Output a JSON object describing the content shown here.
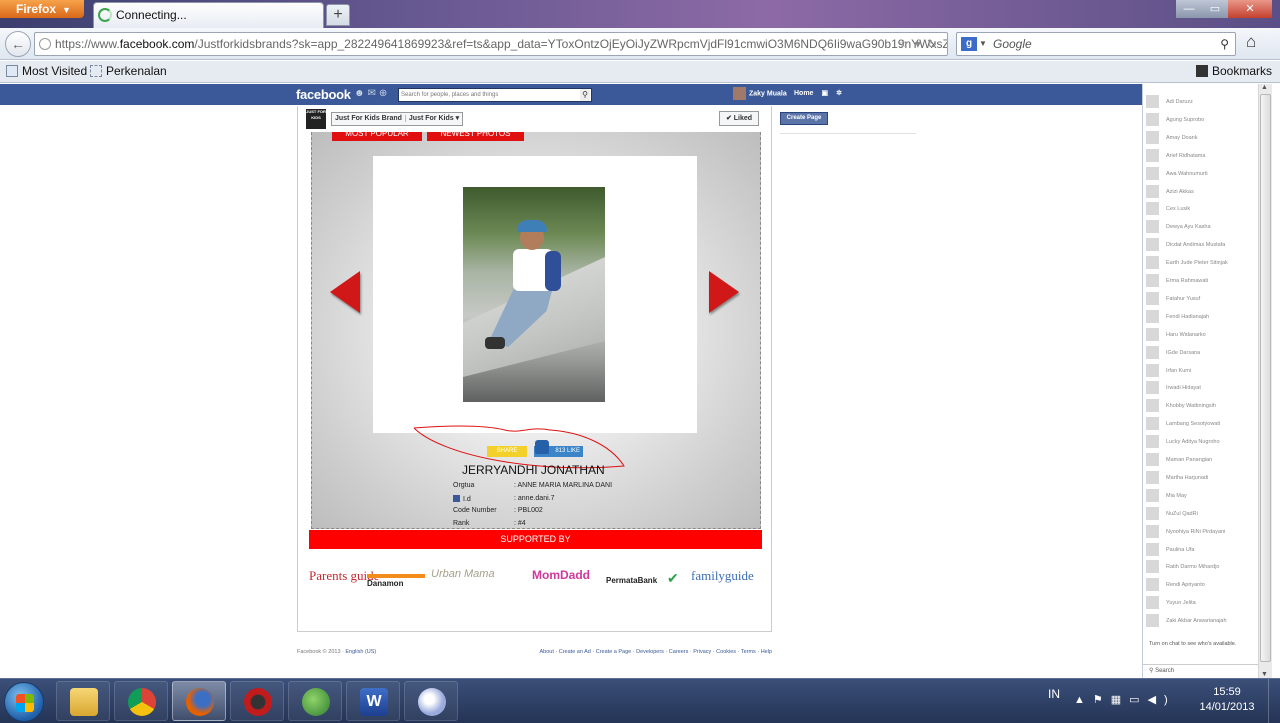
{
  "browser": {
    "menu_label": "Firefox",
    "tab_title": "Connecting...",
    "new_tab_label": "+",
    "url_prefix": "https://www.",
    "url_domain": "facebook.com",
    "url_rest": "/Justforkidsbrands?sk=app_282249641869923&ref=ts&app_data=YToxOntzOjEyOiJyZWRpcmVjdFl91cmwiO3M6NDQ6Ii9waG90b19nYWxsZXJ5L",
    "search_engine": "Google",
    "search_placeholder": "Google",
    "bookmarks": [
      "Most Visited",
      "Perkenalan"
    ],
    "bookmarks_menu": "Bookmarks"
  },
  "facebook": {
    "logo": "facebook",
    "search_placeholder": "Search for people, places and things",
    "user_name": "Zaky Muala",
    "nav": [
      "Home"
    ],
    "page_crumbs": [
      "Just For Kids Brand",
      "Just For Kids ▾"
    ],
    "page_thumb_text": "JUST FOR KIDS",
    "liked_label": "✔ Liked",
    "create_page_label": "Create Page",
    "footer_copyright": "Facebook © 2013 · ",
    "footer_language": "English (US)",
    "footer_links": "About · Create an Ad · Create a Page · Developers · Careers · Privacy · Cookies · Terms · Help"
  },
  "app": {
    "top_buttons": [
      "MOST POPULAR",
      "NEWEST PHOTOS"
    ],
    "share_label": "SHARE",
    "like_label": "813 LIKE",
    "kid_name": "JERRYANDHI JONATHAN",
    "details": [
      {
        "key": "Orgtua",
        "value": ": ANNE MARIA MARLINA DANI"
      },
      {
        "key": "I.d",
        "value": ": anne.dani.7"
      },
      {
        "key": "Code Number",
        "value": ": PBL002"
      },
      {
        "key": "Rank",
        "value": ": #4"
      }
    ],
    "supported_by": "SUPPORTED BY",
    "sponsors": [
      "Parents guide",
      "Danamon",
      "Urban Mama",
      "MomDadd",
      "PermataBank",
      "✔",
      "familyguide"
    ]
  },
  "chat": {
    "friends": [
      "Adi Daruzz",
      "Agung Suprobo",
      "Amay Doank",
      "Arief Ridhatama",
      "Awa Wahnumurti",
      "Azizi Akkas",
      "Cex Lusik",
      "Dewya Ayu Kasha",
      "Dicdat Andimas Mustafa",
      "Earth Jude Pieter Sitinjak",
      "Erma Rahmawati",
      "Fatahur Yusuf",
      "Fendi Hadianajah",
      "Haru Widanarko",
      "IGde Darsana",
      "Irfan Kumi",
      "Irwadi Hidayat",
      "Khobby Wattiningsih",
      "Lambang Sesotyowati",
      "Lucky Aditya Nugroho",
      "Maman Panangian",
      "Martha Harjunadi",
      "Mia May",
      "NuZul QadRi",
      "Nyoohiya RiNi Pirdayani",
      "Paulina Ufa",
      "Ratih Darmo Mihardjo",
      "Rendi Apriyanto",
      "Yuyun Jelita",
      "Zaki Akbar Anwarianajah"
    ],
    "turn_on_note": "Turn on chat to see who's available.",
    "search_label": "Search"
  },
  "taskbar": {
    "language": "IN",
    "time": "15:59",
    "date": "14/01/2013"
  }
}
